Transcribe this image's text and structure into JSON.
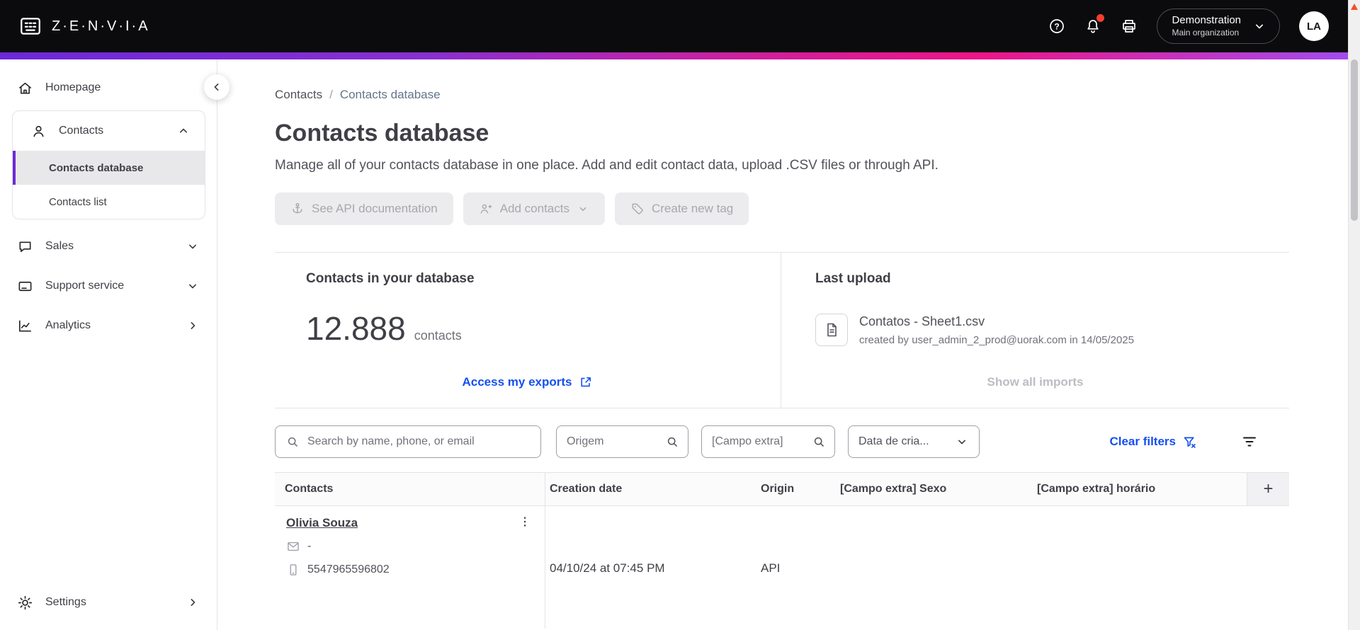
{
  "colors": {
    "accent_purple": "#6d28d9",
    "accent_magenta": "#ee1489",
    "link_blue": "#1450f0",
    "notification_red": "#f43f2e",
    "topbar_black": "#0b0b0d"
  },
  "topbar": {
    "brand": "Z·E·N·V·I·A",
    "org_name": "Demonstration",
    "org_sub": "Main organization",
    "avatar_initials": "LA"
  },
  "sidebar": {
    "items": [
      {
        "label": "Homepage"
      },
      {
        "label": "Contacts"
      },
      {
        "label": "Contacts database"
      },
      {
        "label": "Contacts list"
      },
      {
        "label": "Sales"
      },
      {
        "label": "Support service"
      },
      {
        "label": "Analytics"
      },
      {
        "label": "Settings"
      }
    ]
  },
  "breadcrumb": {
    "root": "Contacts",
    "separator": "/",
    "current": "Contacts database"
  },
  "page": {
    "title": "Contacts database",
    "subtitle": "Manage all of your contacts database in one place. Add and edit contact data, upload .CSV files or through API."
  },
  "actions": {
    "see_api_documentation": "See API documentation",
    "add_contacts": "Add contacts",
    "create_new_tag": "Create new tag"
  },
  "summary": {
    "database_card": {
      "title": "Contacts in your database",
      "count": "12.888",
      "unit": "contacts",
      "exports_link": "Access my exports"
    },
    "upload_card": {
      "title": "Last upload",
      "filename": "Contatos - Sheet1.csv",
      "meta": "created by user_admin_2_prod@uorak.com in 14/05/2025",
      "imports_link": "Show all imports"
    }
  },
  "filters": {
    "search_placeholder": "Search by name, phone, or email",
    "origin_placeholder": "Origem",
    "extra_field_placeholder": "[Campo extra]",
    "creation_date_label": "Data de cria...",
    "clear_label": "Clear filters"
  },
  "table": {
    "columns": {
      "contacts": "Contacts",
      "creation_date": "Creation date",
      "origin": "Origin",
      "extra_sexo": "[Campo extra] Sexo",
      "extra_horario": "[Campo extra] horário"
    },
    "add_column": "+",
    "rows": [
      {
        "name": "Olivia Souza",
        "email": "-",
        "phone": "5547965596802",
        "creation_date": "04/10/24 at 07:45 PM",
        "origin": "API"
      }
    ]
  }
}
